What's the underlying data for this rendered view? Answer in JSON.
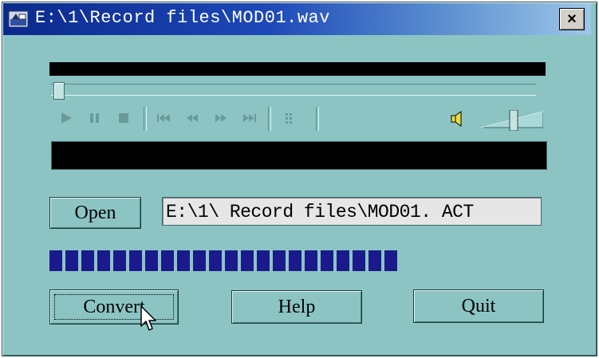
{
  "window": {
    "title": "E:\\1\\Record files\\MOD01.wav",
    "close_label": "×"
  },
  "player": {
    "progress_fraction": 0.74,
    "volume_fraction": 0.55
  },
  "controls": {
    "open_label": "Open",
    "path_value": "E:\\1\\ Record files\\MOD01. ACT",
    "convert_label": "Convert",
    "help_label": "Help",
    "quit_label": "Quit"
  },
  "colors": {
    "window_bg": "#8cc4c4",
    "progress_fill": "#1a1a8c",
    "title_bar": "#0a2a8c"
  }
}
